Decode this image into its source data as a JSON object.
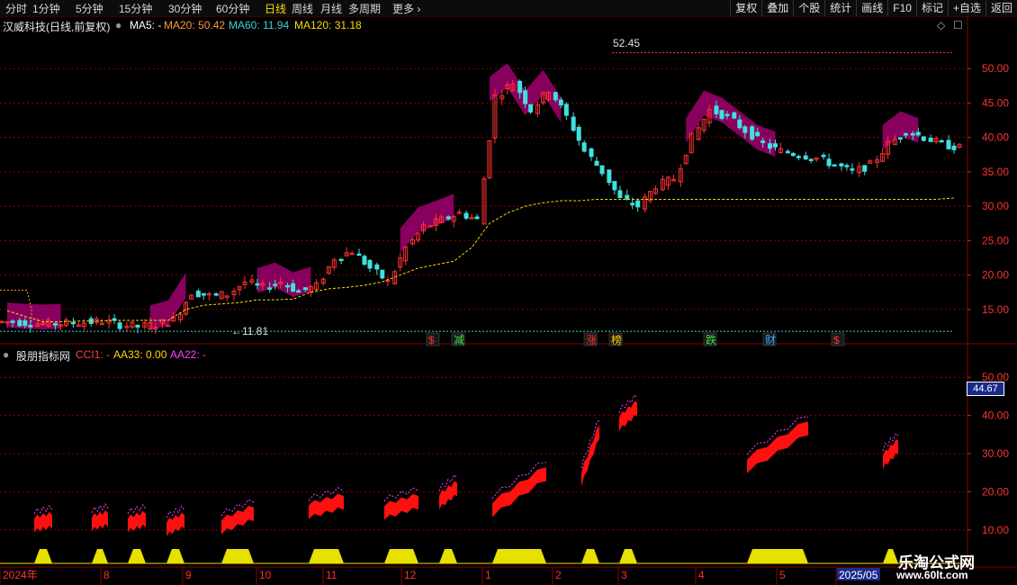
{
  "toolbar": {
    "periods": [
      "分时",
      "1分钟",
      "5分钟",
      "15分钟",
      "30分钟",
      "60分钟",
      "日线",
      "周线",
      "月线",
      "多周期",
      "更多"
    ],
    "active_period": "日线",
    "buttons": [
      "复权",
      "叠加",
      "个股",
      "统计",
      "画线",
      "F10",
      "标记",
      "+自选",
      "返回"
    ]
  },
  "main_panel": {
    "title": "汉威科技(日线,前复权)",
    "ma5_label": "MA5: -",
    "ma20_label": "MA20: 50.42",
    "ma60_label": "MA60: 11.94",
    "ma120_label": "MA120: 31.18",
    "high_marker": "52.45",
    "low_marker": "11.81",
    "y_ticks": [
      "50.00",
      "45.00",
      "40.00",
      "35.00",
      "30.00",
      "25.00",
      "20.00",
      "15.00"
    ],
    "event_tags": [
      {
        "text": "$",
        "color": "#ff3030"
      },
      {
        "text": "减",
        "color": "#40e040"
      },
      {
        "text": "涨",
        "color": "#ff3030"
      },
      {
        "text": "榜",
        "color": "#ffd000"
      },
      {
        "text": "跌",
        "color": "#40e040"
      },
      {
        "text": "财",
        "color": "#40a0ff"
      },
      {
        "text": "$",
        "color": "#ff3030"
      }
    ]
  },
  "indicator_panel": {
    "title": "股朋指标网",
    "cci_label": "CCI1: -",
    "aa33_label": "AA33: 0.00",
    "aa22_label": "AA22: -",
    "current_value": "44.67",
    "y_ticks": [
      "50.00",
      "40.00",
      "30.00",
      "20.00",
      "10.00"
    ]
  },
  "time_axis": [
    "2024年",
    "8",
    "9",
    "10",
    "11",
    "12",
    "1",
    "2",
    "3",
    "4",
    "5",
    "2025/05"
  ],
  "watermark": {
    "line1": "乐淘公式网",
    "line2": "www.60lt.com"
  },
  "colors": {
    "up": "#ff3030",
    "down": "#40e0e0",
    "band": "#a0006e",
    "ma_yellow": "#ffd800",
    "grid": "#8b0000",
    "accent_red": "#ff1010",
    "pink": "#ff40ff"
  },
  "chart_data": {
    "type": "line",
    "title": "汉威科技(日线,前复权)",
    "price_range": [
      10,
      53
    ],
    "ma120_path_x": [
      0,
      3,
      4,
      5,
      6,
      7,
      8,
      9,
      10,
      11,
      12,
      13,
      14,
      15,
      16,
      17,
      18,
      19,
      20,
      21,
      22,
      23,
      24,
      25,
      26,
      27,
      28,
      29
    ],
    "close": [
      13.2,
      13.0,
      12.9,
      13.0,
      13.1,
      13.3,
      12.8,
      12.5,
      12.8,
      13.5,
      17.5,
      17.0,
      17.2,
      19.0,
      18.2,
      19.0,
      17.6,
      18.4,
      22.5,
      23.5,
      21.0,
      19.0,
      24.0,
      27.0,
      28.0,
      29.0,
      28.0,
      46.0,
      48.0,
      44.0,
      47.0,
      43.0,
      38.0,
      35.0,
      31.0,
      30.0,
      33.0,
      34.0,
      40.0,
      44.0,
      43.0,
      41.0,
      39.0,
      38.0,
      37.5,
      37.0,
      36.0,
      35.0,
      36.0,
      39.0,
      41.0,
      40.0,
      39.0,
      38.5
    ],
    "ma_yellow": [
      14.8,
      14.0,
      13.2,
      13.2,
      13.3,
      13.3,
      13.4,
      13.4,
      13.4,
      13.4,
      15.0,
      15.6,
      15.8,
      16.0,
      16.4,
      16.4,
      16.5,
      17.5,
      18.0,
      18.2,
      18.5,
      19.0,
      20.0,
      21.0,
      21.5,
      22.0,
      24.0,
      27.5,
      29.0,
      30.0,
      30.5,
      30.8,
      30.8,
      31.0,
      31.0,
      31.0,
      31.0,
      31.0,
      31.0,
      31.0,
      31.0,
      31.0,
      31.0,
      31.0,
      31.0,
      31.0,
      31.0,
      31.0,
      31.0,
      31.0,
      31.0,
      31.0,
      31.0,
      31.2
    ],
    "indicator_range": [
      5,
      55
    ],
    "indicator_segments": [
      {
        "values": [
          11.5,
          12.5
        ]
      },
      {
        "values": [
          11.8,
          13.0
        ]
      },
      {
        "values": [
          11.5,
          12.8
        ]
      },
      {
        "values": [
          10.5,
          12.5
        ]
      },
      {
        "values": [
          11.0,
          14.5
        ]
      },
      {
        "values": [
          15.0,
          17.5
        ]
      },
      {
        "values": [
          14.8,
          17.5
        ]
      },
      {
        "values": [
          17.5,
          21.0
        ]
      },
      {
        "values": [
          15.5,
          25.0
        ]
      },
      {
        "values": [
          23.5,
          36.0
        ]
      },
      {
        "values": [
          38.0,
          42.0
        ]
      },
      {
        "values": [
          27.0,
          37.0
        ]
      },
      {
        "values": [
          28.0,
          32.0
        ]
      }
    ]
  }
}
